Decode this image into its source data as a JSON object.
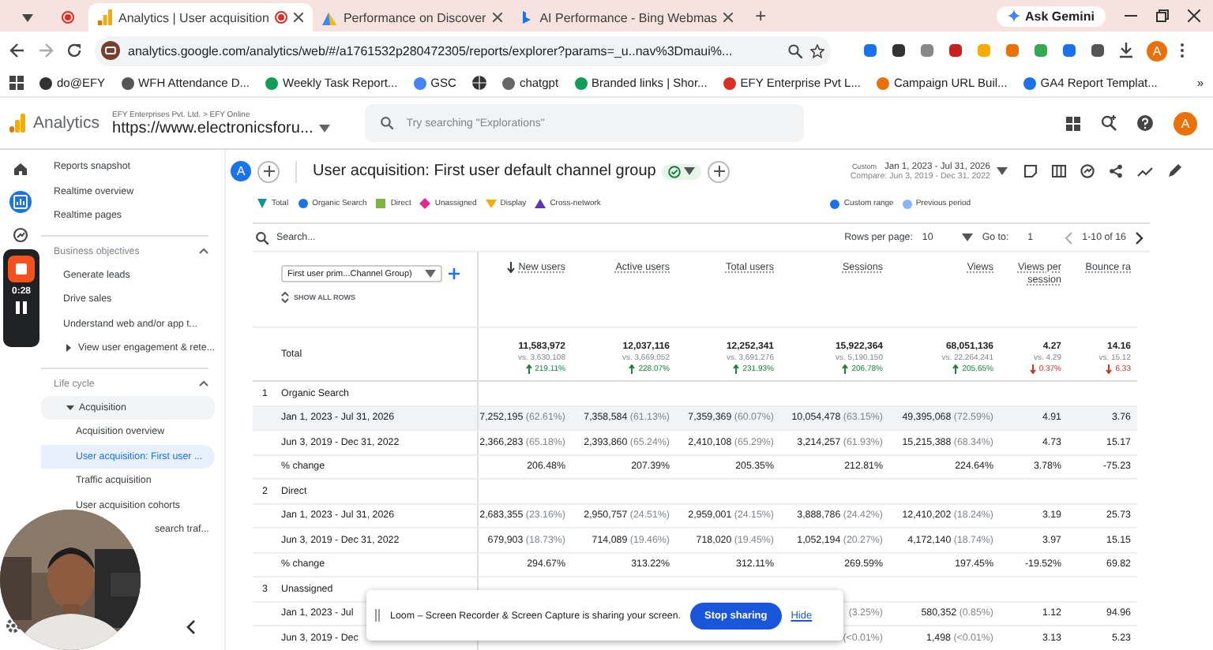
{
  "browser": {
    "tabs": [
      {
        "title": "Analytics | User acquisition",
        "selected": true,
        "kind": "analytics"
      },
      {
        "title": "Performance on Discover",
        "selected": false,
        "kind": "console"
      },
      {
        "title": "AI Performance - Bing Webmas",
        "selected": false,
        "kind": "bing"
      }
    ],
    "new_tab": "+",
    "gemini": "Ask Gemini",
    "url": "analytics.google.com/analytics/web/#/a1761532p280472305/reports/explorer?params=_u..nav%3Dmaui%...",
    "profile": "A",
    "bookmarks": [
      {
        "kind": "link",
        "label": "do@EFY"
      },
      {
        "kind": "link",
        "label": "WFH Attendance D..."
      },
      {
        "kind": "link",
        "label": "Weekly Task Report..."
      },
      {
        "kind": "link",
        "label": "GSC"
      },
      {
        "kind": "icon"
      },
      {
        "kind": "link",
        "label": "chatgpt"
      },
      {
        "kind": "link",
        "label": "Branded links | Shor..."
      },
      {
        "kind": "link",
        "label": "EFY Enterprise Pvt L..."
      },
      {
        "kind": "link",
        "label": "Campaign URL Buil..."
      },
      {
        "kind": "link",
        "label": "GA4 Report Templat..."
      }
    ],
    "more_bookmarks": "»"
  },
  "app": {
    "name": "Analytics",
    "account_path": "EFY Enterprises Pvt. Ltd. > EFY Online",
    "property": "https://www.electronicsforu...",
    "search": {
      "placeholder": "Try searching \"Explorations\""
    },
    "avatar": "A"
  },
  "rail": [
    {
      "kind": "home",
      "selected": false
    },
    {
      "kind": "reports",
      "selected": true
    },
    {
      "kind": "explore",
      "selected": false
    }
  ],
  "recorder": {
    "time": "0:28"
  },
  "sidebar": {
    "items": [
      {
        "label": "Reports snapshot",
        "selected": false
      },
      {
        "label": "Realtime overview",
        "selected": false
      },
      {
        "label": "Realtime pages",
        "selected": false
      }
    ],
    "sections": [
      {
        "title": "Business objectives",
        "expanded": true,
        "items": [
          {
            "label": "Generate leads",
            "selected": false
          },
          {
            "label": "Drive sales",
            "selected": false
          },
          {
            "label": "Understand web and/or app t...",
            "selected": false
          },
          {
            "label": "View user engagement & rete...",
            "kind": "group",
            "expanded": false
          }
        ]
      },
      {
        "title": "Life cycle",
        "expanded": true,
        "items": [
          {
            "label": "Acquisition",
            "kind": "group",
            "expanded": true,
            "children": [
              {
                "label": "Acquisition overview",
                "selected": false
              },
              {
                "label": "User acquisition: First user ...",
                "selected": true
              },
              {
                "label": "Traffic acquisition",
                "selected": false
              },
              {
                "label": "User acquisition cohorts",
                "selected": false
              },
              {
                "label": "search traf...",
                "kind": "covered",
                "selected": false
              }
            ]
          }
        ]
      }
    ]
  },
  "report": {
    "avatar": "A",
    "title": "User acquisition: First user default channel group",
    "date_label": "Custom",
    "date_range": "Jan 1, 2023 - Jul 31, 2026",
    "compare": "Compare: Jun 3, 2019 - Dec 31, 2022"
  },
  "legend": [
    {
      "label": "Total",
      "kind": "drop",
      "color": "#12939a"
    },
    {
      "label": "Organic Search",
      "kind": "circle",
      "color": "#1a73e8"
    },
    {
      "label": "Direct",
      "kind": "square",
      "color": "#7cb342"
    },
    {
      "label": "Unassigned",
      "kind": "diamond",
      "color": "#e52592"
    },
    {
      "label": "Display",
      "kind": "triangle-down",
      "color": "#f9ab00"
    },
    {
      "label": "Cross-network",
      "kind": "triangle",
      "color": "#5e35b1"
    }
  ],
  "period_legend": [
    {
      "label": "Custom range",
      "color": "#1a73e8"
    },
    {
      "label": "Previous period",
      "color": "#8ab4f8"
    }
  ],
  "table": {
    "search_placeholder": "Search...",
    "rows_per_page_label": "Rows per page:",
    "rows_per_page": "10",
    "goto_label": "Go to:",
    "goto": "1",
    "pagination": "1-10 of 16",
    "dimension": "First user prim...Channel Group)",
    "show_all": "SHOW ALL ROWS",
    "columns": [
      {
        "label": "New users",
        "sorted": true
      },
      {
        "label": "Active users",
        "sorted": false
      },
      {
        "label": "Total users",
        "sorted": false
      },
      {
        "label": "Sessions",
        "sorted": false
      },
      {
        "label": "Views",
        "sorted": false
      },
      {
        "label": "Views per session",
        "sorted": false
      },
      {
        "label": "Bounce ra",
        "sorted": false
      }
    ],
    "total": {
      "label": "Total",
      "cells": [
        {
          "value": "11,583,972",
          "compare": "vs. 3,630,108",
          "change": "219.11%",
          "increase": true
        },
        {
          "value": "12,037,116",
          "compare": "vs. 3,669,052",
          "change": "228.07%",
          "increase": true
        },
        {
          "value": "12,252,341",
          "compare": "vs. 3,691,276",
          "change": "231.93%",
          "increase": true
        },
        {
          "value": "15,922,364",
          "compare": "vs. 5,190,150",
          "change": "206.78%",
          "increase": true
        },
        {
          "value": "68,051,136",
          "compare": "vs. 22,264,241",
          "change": "205.65%",
          "increase": true
        },
        {
          "value": "4.27",
          "compare": "vs. 4.29",
          "change": "0.37%",
          "increase": false
        },
        {
          "value": "14.16",
          "compare": "vs. 15.12",
          "change": "6.33",
          "increase": false
        }
      ]
    },
    "groups": [
      {
        "index": "1",
        "name": "Organic Search",
        "rows": [
          {
            "label": "Jan 1, 2023 - Jul 31, 2026",
            "hovered": true,
            "cells": [
              [
                "7,252,195",
                "(62.61%)"
              ],
              [
                "7,358,584",
                "(61.13%)"
              ],
              [
                "7,359,369",
                "(60.07%)"
              ],
              [
                "10,054,478",
                "(63.15%)"
              ],
              [
                "49,395,068",
                "(72.59%)"
              ],
              [
                "4.91"
              ],
              [
                "3.76"
              ]
            ]
          },
          {
            "label": "Jun 3, 2019 - Dec 31, 2022",
            "hovered": false,
            "cells": [
              [
                "2,366,283",
                "(65.18%)"
              ],
              [
                "2,393,860",
                "(65.24%)"
              ],
              [
                "2,410,108",
                "(65.29%)"
              ],
              [
                "3,214,257",
                "(61.93%)"
              ],
              [
                "15,215,388",
                "(68.34%)"
              ],
              [
                "4.73"
              ],
              [
                "15.17"
              ]
            ]
          },
          {
            "label": "% change",
            "hovered": false,
            "cells": [
              [
                "206.48%"
              ],
              [
                "207.39%"
              ],
              [
                "205.35%"
              ],
              [
                "212.81%"
              ],
              [
                "224.64%"
              ],
              [
                "3.78%"
              ],
              [
                "-75.23"
              ]
            ]
          }
        ]
      },
      {
        "index": "2",
        "name": "Direct",
        "rows": [
          {
            "label": "Jan 1, 2023 - Jul 31, 2026",
            "hovered": false,
            "cells": [
              [
                "2,683,355",
                "(23.16%)"
              ],
              [
                "2,950,757",
                "(24.51%)"
              ],
              [
                "2,959,001",
                "(24.15%)"
              ],
              [
                "3,888,786",
                "(24.42%)"
              ],
              [
                "12,410,202",
                "(18.24%)"
              ],
              [
                "3.19"
              ],
              [
                "25.73"
              ]
            ]
          },
          {
            "label": "Jun 3, 2019 - Dec 31, 2022",
            "hovered": false,
            "cells": [
              [
                "679,903",
                "(18.73%)"
              ],
              [
                "714,089",
                "(19.46%)"
              ],
              [
                "718,020",
                "(19.45%)"
              ],
              [
                "1,052,194",
                "(20.27%)"
              ],
              [
                "4,172,140",
                "(18.74%)"
              ],
              [
                "3.97"
              ],
              [
                "15.15"
              ]
            ]
          },
          {
            "label": "% change",
            "hovered": false,
            "cells": [
              [
                "294.67%"
              ],
              [
                "313.22%"
              ],
              [
                "312.11%"
              ],
              [
                "269.59%"
              ],
              [
                "197.45%"
              ],
              [
                "-19.52%"
              ],
              [
                "69.82"
              ]
            ]
          }
        ]
      },
      {
        "index": "3",
        "name": "Unassigned",
        "rows": [
          {
            "label": "Jan 1, 2023 - Jul",
            "hovered": false,
            "cells": [
              null,
              null,
              null,
              [
                null,
                "(3.25%)"
              ],
              [
                "580,352",
                "(0.85%)"
              ],
              [
                "1.12"
              ],
              [
                "94.96"
              ]
            ]
          },
          {
            "label": "Jun 3, 2019 - Dec",
            "hovered": false,
            "cells": [
              null,
              null,
              null,
              [
                null,
                "(<0.01%)"
              ],
              [
                "1,498",
                "(<0.01%)"
              ],
              [
                "3.13"
              ],
              [
                "5.23"
              ]
            ]
          }
        ]
      }
    ]
  },
  "loom": {
    "message": "Loom – Screen Recorder & Screen Capture is sharing your screen.",
    "button": "Stop sharing",
    "link": "Hide"
  }
}
